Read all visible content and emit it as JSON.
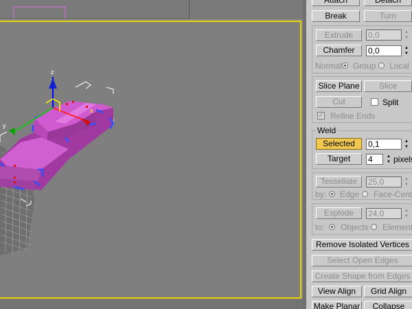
{
  "panel": {
    "attach_label": "Attach",
    "detach_label": "Detach",
    "break_label": "Break",
    "turn_label": "Turn",
    "extrude_label": "Extrude",
    "extrude_value": "0,0",
    "chamfer_label": "Chamfer",
    "chamfer_value": "0,0",
    "normal_label": "Normal:",
    "normal_group": "Group",
    "normal_local": "Local",
    "slice_plane_label": "Slice Plane",
    "slice_label": "Slice",
    "cut_label": "Cut",
    "split_label": "Split",
    "refine_ends_label": "Refine Ends",
    "weld_title": "Weld",
    "selected_label": "Selected",
    "selected_value": "0,1",
    "target_label": "Target",
    "target_value": "4",
    "pixels_label": "pixels",
    "tessellate_label": "Tessellate",
    "tessellate_value": "25,0",
    "by_label": "by:",
    "by_edge": "Edge",
    "by_face_center": "Face-Center",
    "explode_label": "Explode",
    "explode_value": "24,0",
    "to_label": "to:",
    "to_objects": "Objects",
    "to_elements": "Elements",
    "remove_isolated_label": "Remove Isolated Vertices",
    "select_open_edges_label": "Select Open Edges",
    "create_shape_label": "Create Shape from Edges",
    "view_align_label": "View Align",
    "grid_align_label": "Grid Align",
    "make_planar_label": "Make Planar",
    "collapse_label": "Collapse"
  },
  "viewport": {
    "gizmo_z_label": "z",
    "gizmo_y_label": "y",
    "gizmo_x_label": "x",
    "border_color": "#e8d400",
    "object_color": "#c050c0"
  }
}
